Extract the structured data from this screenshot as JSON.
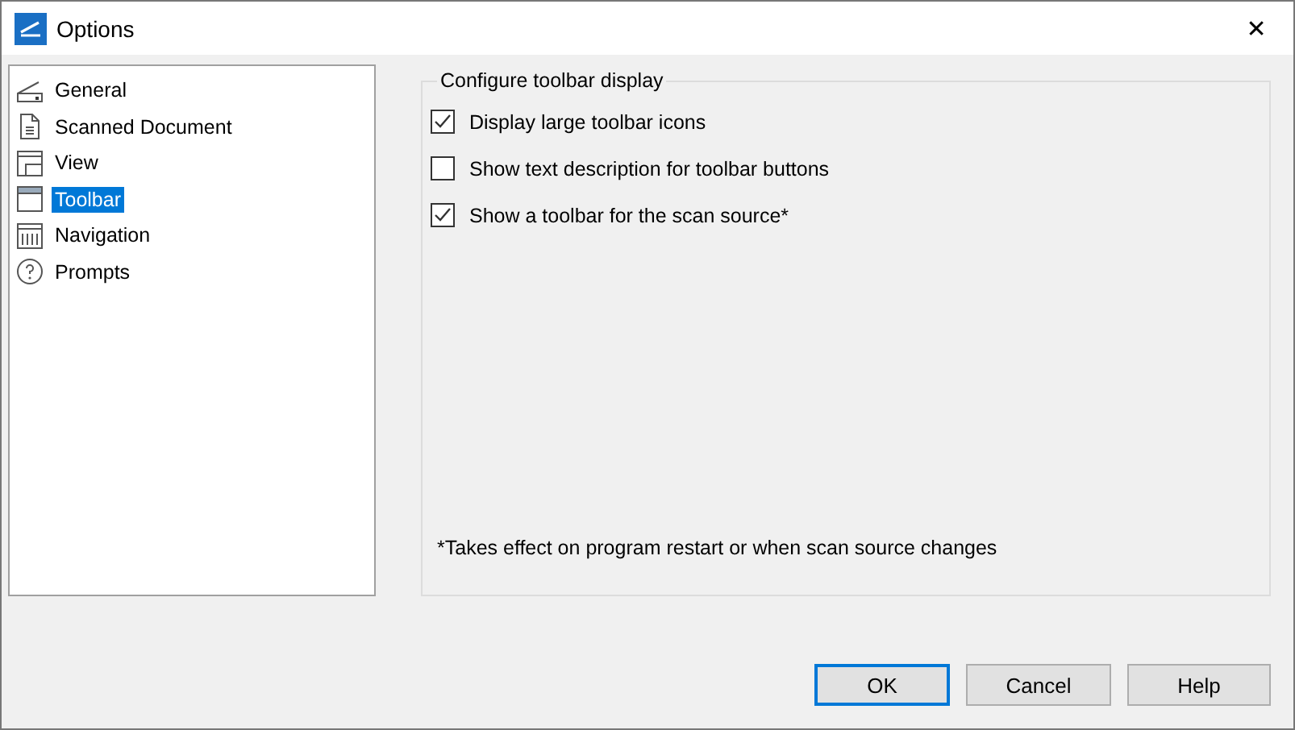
{
  "window": {
    "title": "Options",
    "close": "✕"
  },
  "sidebar": {
    "items": [
      {
        "label": "General",
        "kind": "scanner",
        "selected": false
      },
      {
        "label": "Scanned Document",
        "kind": "document",
        "selected": false
      },
      {
        "label": "View",
        "kind": "view",
        "selected": false
      },
      {
        "label": "Toolbar",
        "kind": "toolbar",
        "selected": true
      },
      {
        "label": "Navigation",
        "kind": "navigation",
        "selected": false
      },
      {
        "label": "Prompts",
        "kind": "help",
        "selected": false
      }
    ]
  },
  "group": {
    "title": "Configure toolbar display",
    "options": [
      {
        "label": "Display large toolbar icons",
        "checked": true
      },
      {
        "label": "Show text description for toolbar buttons",
        "checked": false
      },
      {
        "label": "Show a toolbar for the scan source*",
        "checked": true
      }
    ],
    "note": "*Takes effect on program restart or when scan source changes"
  },
  "buttons": [
    {
      "label": "OK",
      "default": true
    },
    {
      "label": "Cancel",
      "default": false
    },
    {
      "label": "Help",
      "default": false
    }
  ]
}
